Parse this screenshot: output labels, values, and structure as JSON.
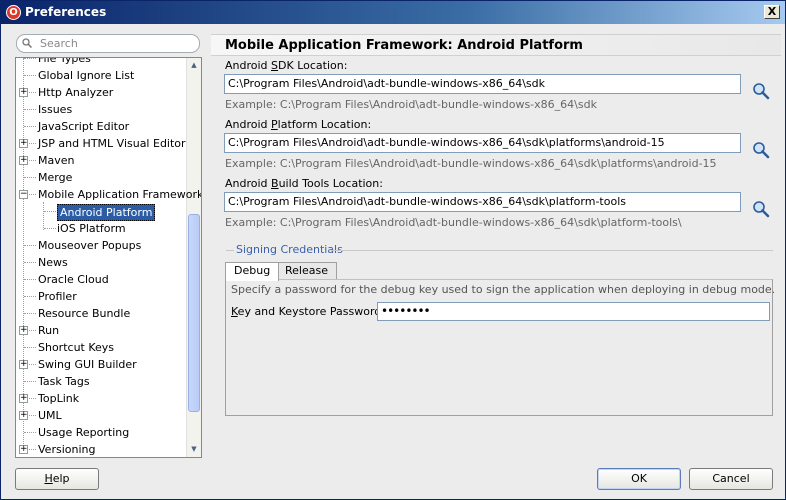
{
  "window": {
    "title": "Preferences",
    "close_glyph": "X",
    "app_icon": "oracle-jdeveloper-icon"
  },
  "search": {
    "placeholder": "Search"
  },
  "tree": {
    "items": [
      {
        "label": "File Types",
        "expandable": false
      },
      {
        "label": "Global Ignore List",
        "expandable": false
      },
      {
        "label": "Http Analyzer",
        "expandable": true
      },
      {
        "label": "Issues",
        "expandable": false
      },
      {
        "label": "JavaScript Editor",
        "expandable": false
      },
      {
        "label": "JSP and HTML Visual Editor",
        "expandable": true
      },
      {
        "label": "Maven",
        "expandable": true
      },
      {
        "label": "Merge",
        "expandable": false
      },
      {
        "label": "Mobile Application Framework",
        "expandable": true,
        "expanded": true
      },
      {
        "label": "Android Platform",
        "child": true,
        "selected": true
      },
      {
        "label": "iOS Platform",
        "child": true
      },
      {
        "label": "Mouseover Popups",
        "expandable": false
      },
      {
        "label": "News",
        "expandable": false
      },
      {
        "label": "Oracle Cloud",
        "expandable": false
      },
      {
        "label": "Profiler",
        "expandable": false
      },
      {
        "label": "Resource Bundle",
        "expandable": false
      },
      {
        "label": "Run",
        "expandable": true
      },
      {
        "label": "Shortcut Keys",
        "expandable": false
      },
      {
        "label": "Swing GUI Builder",
        "expandable": true
      },
      {
        "label": "Task Tags",
        "expandable": false
      },
      {
        "label": "TopLink",
        "expandable": true
      },
      {
        "label": "UML",
        "expandable": true
      },
      {
        "label": "Usage Reporting",
        "expandable": false
      },
      {
        "label": "Versioning",
        "expandable": true
      }
    ]
  },
  "page": {
    "title": "Mobile Application Framework: Android Platform",
    "sdk": {
      "label_pre": "Android ",
      "label_mnemonic": "S",
      "label_post": "DK Location:",
      "value": "C:\\Program Files\\Android\\adt-bundle-windows-x86_64\\sdk",
      "example": "Example: C:\\Program Files\\Android\\adt-bundle-windows-x86_64\\sdk"
    },
    "platform": {
      "label_pre": "Android ",
      "label_mnemonic": "P",
      "label_post": "latform Location:",
      "value": "C:\\Program Files\\Android\\adt-bundle-windows-x86_64\\sdk\\platforms\\android-15",
      "example": "Example: C:\\Program Files\\Android\\adt-bundle-windows-x86_64\\sdk\\platforms\\android-15"
    },
    "build_tools": {
      "label_pre": "Android ",
      "label_mnemonic": "B",
      "label_post": "uild Tools Location:",
      "value": "C:\\Program Files\\Android\\adt-bundle-windows-x86_64\\sdk\\platform-tools",
      "example": "Example: C:\\Program Files\\Android\\adt-bundle-windows-x86_64\\sdk\\platform-tools\\"
    },
    "signing": {
      "section_title": "Signing Credentials",
      "tabs": [
        "Debug",
        "Release"
      ],
      "active_tab": "Debug",
      "description": "Specify a password for the debug key used to sign the application when deploying in debug mode.",
      "password_label_mnemonic": "K",
      "password_label_post": "ey and Keystore Password:",
      "password_value": "••••••••"
    }
  },
  "buttons": {
    "help_mnemonic": "H",
    "help_post": "elp",
    "ok": "OK",
    "cancel": "Cancel"
  }
}
